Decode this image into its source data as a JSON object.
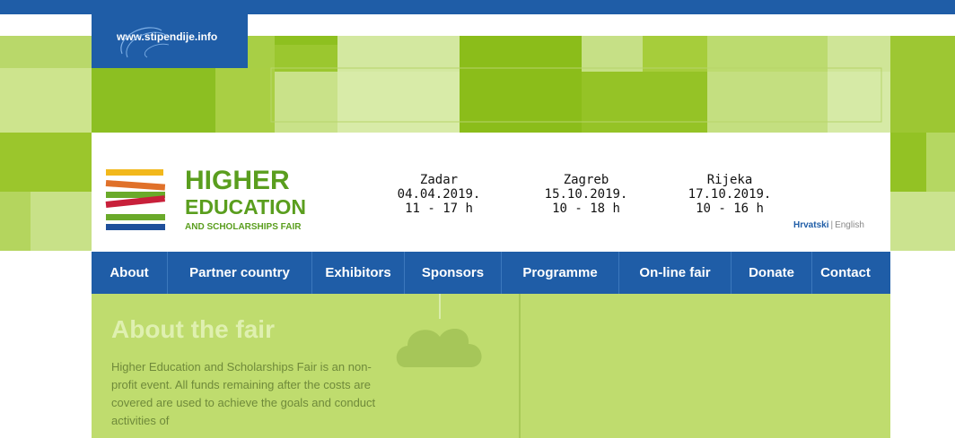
{
  "site": {
    "link": "www.stipendije.info"
  },
  "logo": {
    "line1": "HIGHER",
    "line2": "EDUCATION",
    "line3": "AND SCHOLARSHIPS FAIR"
  },
  "venues": [
    {
      "city": "Zadar",
      "date": "04.04.2019.",
      "hours": "11 - 17 h"
    },
    {
      "city": "Zagreb",
      "date": "15.10.2019.",
      "hours": "10 - 18 h"
    },
    {
      "city": "Rijeka",
      "date": "17.10.2019.",
      "hours": "10 - 16 h"
    }
  ],
  "languages": {
    "croatian": "Hrvatski",
    "separator": "|",
    "english": "English"
  },
  "nav": [
    {
      "label": "About"
    },
    {
      "label": "Partner country"
    },
    {
      "label": "Exhibitors"
    },
    {
      "label": "Sponsors"
    },
    {
      "label": "Programme"
    },
    {
      "label": "On-line fair"
    },
    {
      "label": "Donate"
    },
    {
      "label": "Contact"
    }
  ],
  "about": {
    "title": "About the fair",
    "text": "Higher Education and Scholarships Fair is an non-profit event. All funds remaining after the costs are covered are used to achieve the goals and conduct activities of"
  },
  "colors": {
    "brand_blue": "#1f5da7",
    "green_dark": "#5a9e1e",
    "content_bg": "#bfdc6e",
    "logo_yellow": "#f2b81c",
    "logo_orange": "#e0712a",
    "logo_red": "#c8203a",
    "logo_green": "#6aaa2a",
    "logo_blue": "#1f4f9b"
  }
}
